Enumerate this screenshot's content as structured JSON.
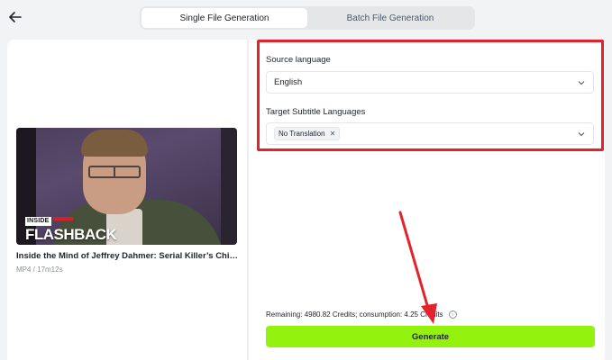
{
  "header": {
    "back_icon": "arrow-left-icon",
    "tabs": [
      {
        "label": "Single File Generation",
        "active": true
      },
      {
        "label": "Batch File Generation",
        "active": false
      }
    ]
  },
  "video": {
    "thumbnail_badge_top": "INSIDE",
    "thumbnail_badge_main": "FLASHBACK",
    "title": "Inside the Mind of Jeffrey Dahmer: Serial Killer’s Chilling …",
    "meta": "MP4 / 17m12s"
  },
  "form": {
    "source_language_label": "Source language",
    "source_language_value": "English",
    "target_label": "Target Subtitle Languages",
    "target_chips": [
      "No Translation"
    ]
  },
  "footer": {
    "credits_text": "Remaining: 4980.82 Credits; consumption: 4.25 Credits",
    "generate_label": "Generate"
  },
  "colors": {
    "accent": "#94f30e",
    "highlight": "#e3222c"
  }
}
